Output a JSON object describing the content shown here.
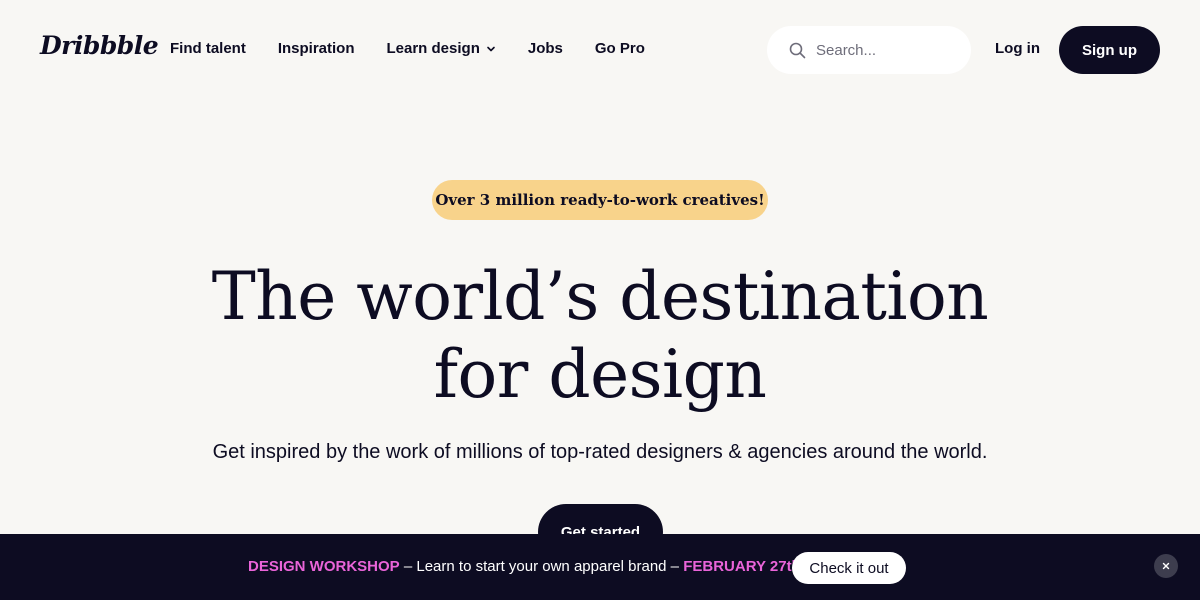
{
  "header": {
    "logo_text": "Dribbble",
    "nav_items": [
      {
        "label": "Find talent"
      },
      {
        "label": "Inspiration"
      },
      {
        "label": "Learn design",
        "has_dropdown": true
      },
      {
        "label": "Jobs"
      },
      {
        "label": "Go Pro"
      }
    ],
    "search": {
      "placeholder": "Search...",
      "value": "",
      "icon": "search-icon"
    },
    "login_label": "Log in",
    "signup_label": "Sign up"
  },
  "hero": {
    "badge": "Over 3 million ready-to-work creatives!",
    "headline_line1": "The world’s destination",
    "headline_line2": "for design",
    "subheadline": "Get inspired by the work of millions of top-rated designers & agencies around the world.",
    "cta_label": "Get started"
  },
  "banner": {
    "highlight_1": "DESIGN WORKSHOP",
    "text_middle": " – Learn to start your own apparel brand – ",
    "highlight_2": "FEBRUARY 27th",
    "button_label": "Check it out",
    "close_icon": "close-icon"
  },
  "colors": {
    "background": "#f8f7f4",
    "primary_dark": "#0d0c22",
    "badge_bg": "#f8d38b",
    "banner_highlight": "#ea64d9"
  }
}
